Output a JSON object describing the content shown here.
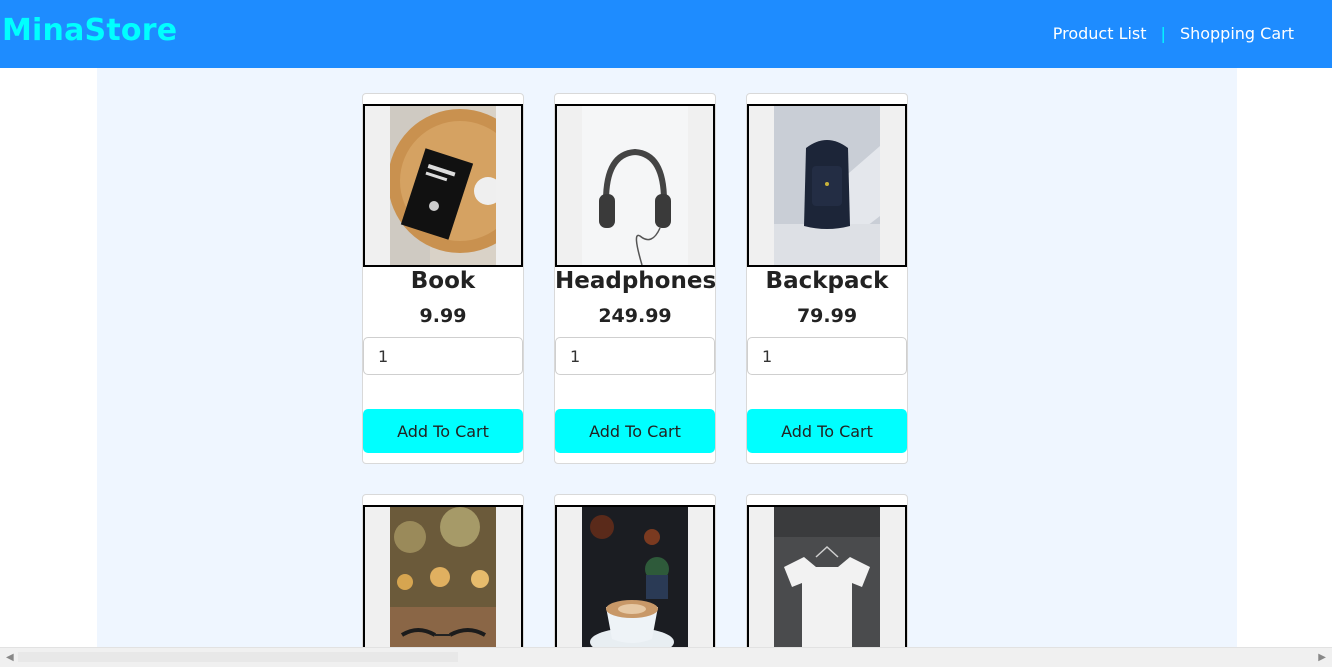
{
  "header": {
    "brand": "MinaStore",
    "nav": [
      {
        "label": "Product List"
      },
      {
        "label": "|"
      },
      {
        "label": "Shopping Cart"
      }
    ],
    "colors": {
      "bar": "#1e8cff",
      "brand": "#00ffff"
    }
  },
  "products": [
    {
      "name": "Book",
      "price": "9.99",
      "qty": "1",
      "button": "Add To Cart"
    },
    {
      "name": "Headphones",
      "price": "249.99",
      "qty": "1",
      "button": "Add To Cart"
    },
    {
      "name": "Backpack",
      "price": "79.99",
      "qty": "1",
      "button": "Add To Cart"
    },
    {
      "name": "",
      "price": "",
      "qty": "",
      "button": ""
    },
    {
      "name": "",
      "price": "",
      "qty": "",
      "button": ""
    },
    {
      "name": "",
      "price": "",
      "qty": "",
      "button": ""
    }
  ],
  "icons": {
    "scroll_left": "scroll-left-arrow-icon",
    "scroll_right": "scroll-right-arrow-icon"
  }
}
